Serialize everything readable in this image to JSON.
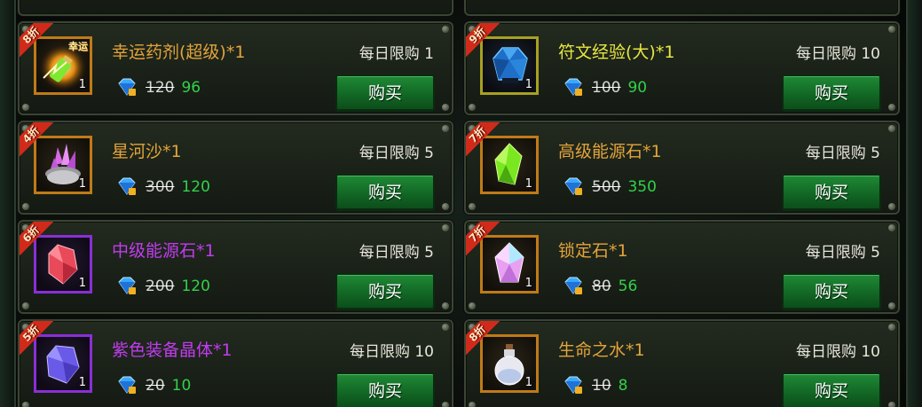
{
  "buy_label": "购买",
  "items": [
    {
      "discount": "8折",
      "name": "幸运药剂(超级)*1",
      "limit": "每日限购 1",
      "old_price": "120",
      "new_price": "96",
      "count": "1",
      "badge": "幸运",
      "icon": "lucky-potion-icon",
      "frame_color": "#c07a18",
      "name_color": "#e3a43a"
    },
    {
      "discount": "9折",
      "name": "符文经验(大)*1",
      "limit": "每日限购 10",
      "old_price": "100",
      "new_price": "90",
      "count": "1",
      "icon": "rune-exp-crystal-icon",
      "frame_color": "#a8a020",
      "name_color": "#e8e640"
    },
    {
      "discount": "4折",
      "name": "星河沙*1",
      "limit": "每日限购 5",
      "old_price": "300",
      "new_price": "120",
      "count": "1",
      "icon": "star-sand-icon",
      "frame_color": "#c07a18",
      "name_color": "#e3a43a"
    },
    {
      "discount": "7折",
      "name": "高级能源石*1",
      "limit": "每日限购 5",
      "old_price": "500",
      "new_price": "350",
      "count": "1",
      "icon": "green-energy-stone-icon",
      "frame_color": "#c07a18",
      "name_color": "#e3a43a"
    },
    {
      "discount": "6折",
      "name": "中级能源石*1",
      "limit": "每日限购 5",
      "old_price": "200",
      "new_price": "120",
      "count": "1",
      "icon": "red-energy-stone-icon",
      "frame_color": "#8a2fd6",
      "name_color": "#c13cf0"
    },
    {
      "discount": "7折",
      "name": "锁定石*1",
      "limit": "每日限购 5",
      "old_price": "80",
      "new_price": "56",
      "count": "1",
      "icon": "lock-stone-icon",
      "frame_color": "#c07a18",
      "name_color": "#e3a43a"
    },
    {
      "discount": "5折",
      "name": "紫色装备晶体*1",
      "limit": "每日限购 10",
      "old_price": "20",
      "new_price": "10",
      "count": "1",
      "icon": "purple-crystal-icon",
      "frame_color": "#8a2fd6",
      "name_color": "#c13cf0"
    },
    {
      "discount": "8折",
      "name": "生命之水*1",
      "limit": "每日限购 10",
      "old_price": "10",
      "new_price": "8",
      "count": "1",
      "icon": "water-of-life-icon",
      "frame_color": "#c07a18",
      "name_color": "#e3a43a"
    }
  ]
}
